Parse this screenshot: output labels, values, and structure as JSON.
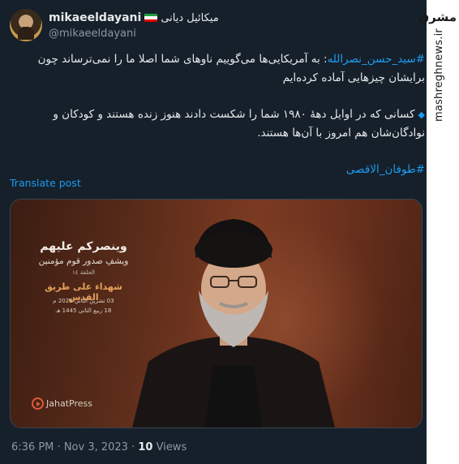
{
  "author": {
    "display_name": "mikaeeldayani",
    "display_name_fa": "میکائیل دیانی",
    "handle": "@mikaeeldayani",
    "flag_colors": [
      "#239f40",
      "#ffffff",
      "#da0000"
    ]
  },
  "tweet": {
    "hashtag1": "#سید_حسن_نصرالله",
    "line1_rest": ": به آمریکایی‌ها می‌گوییم ناوهای شما اصلا ما را نمی‌ترساند چون برایشان چیزهایی آماده کرده‌ایم",
    "bullet_text": "کسانی که در اوایل دههٔ ۱۹۸۰ شما را شکست دادند هنوز زنده هستند و کودکان و نوادگان‌شان هم امروز با آن‌ها هستند.",
    "hashtag2": "#طوفان_الاقصی"
  },
  "translate_label": "Translate post",
  "media": {
    "title": "وينصركم عليهم",
    "subtitle": "ويشفِ صدور قوم مؤمنين",
    "part": "الحلقة ١٤",
    "red_title": "شهداء على طريق القدس",
    "date1": "03 تشرين الثاني 2023 م",
    "date2": "18 ربيع الثاني 1445 هـ",
    "logo_text": "JahatPress"
  },
  "footer": {
    "time": "6:36 PM",
    "sep": "·",
    "date": "Nov 3, 2023",
    "views_count": "10",
    "views_label": "Views"
  },
  "watermark": {
    "logo": "مشرق",
    "site": "mashreghnews.ir"
  },
  "colors": {
    "background": "#15202b",
    "link": "#1d9bf0",
    "muted": "#8b98a5",
    "text": "#e7e9ea"
  }
}
